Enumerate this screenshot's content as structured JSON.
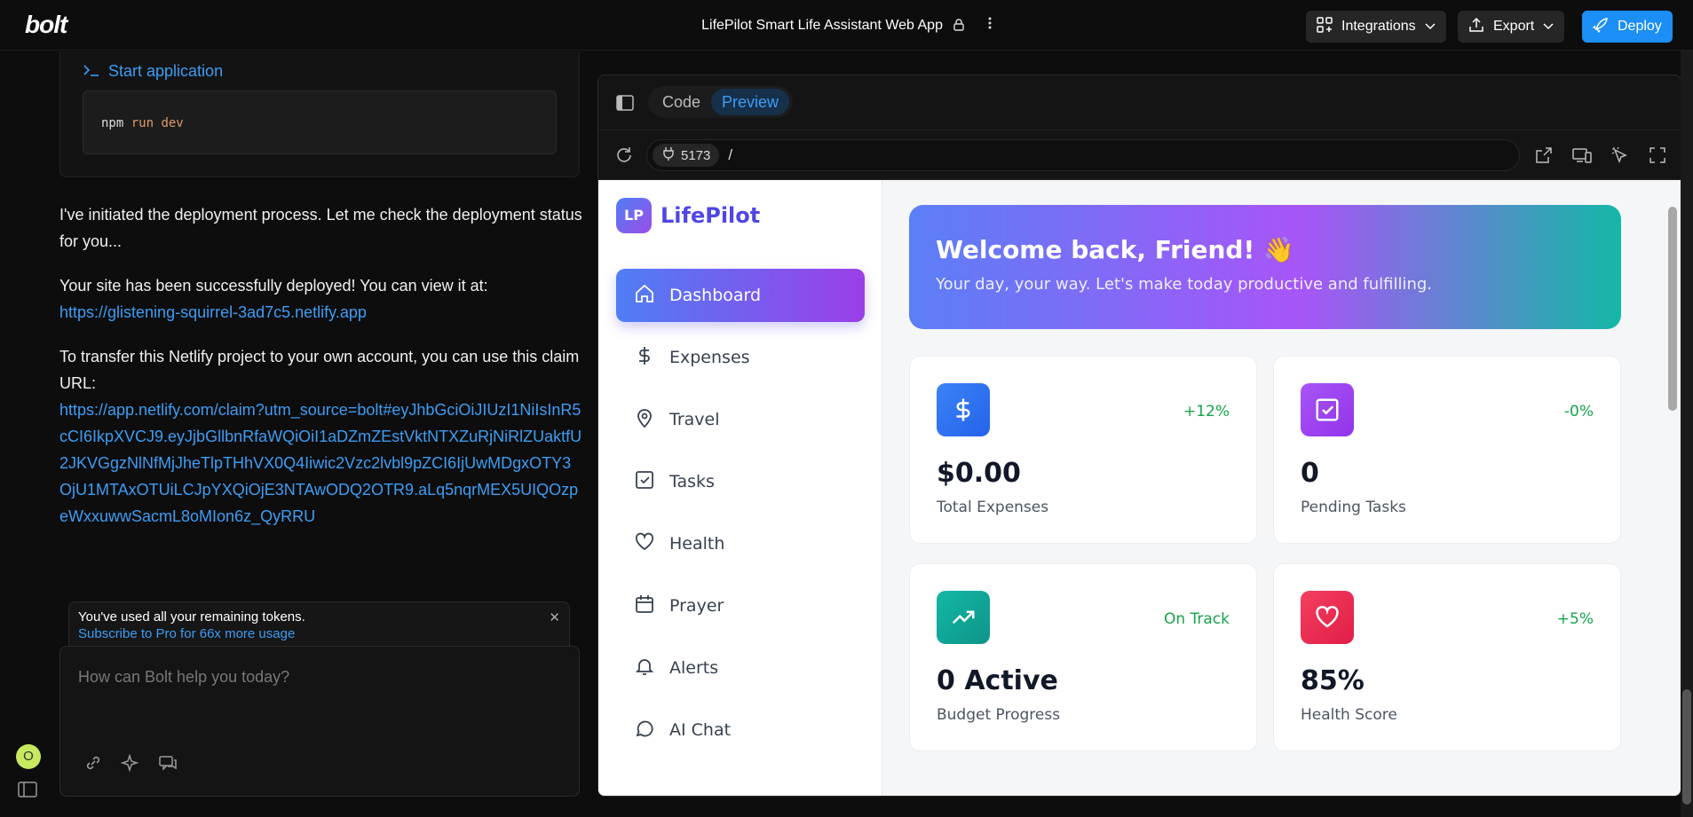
{
  "topbar": {
    "logo": "bolt",
    "project_title": "LifePilot Smart Life Assistant Web App",
    "integrations_label": "Integrations",
    "export_label": "Export",
    "deploy_label": "Deploy"
  },
  "chat": {
    "start_app_label": "Start application",
    "cmd_prefix": "npm",
    "cmd_rest": "run dev",
    "msg1": "I've initiated the deployment process. Let me check the deployment status for you...",
    "msg2": "Your site has been successfully deployed! You can view it at:",
    "site_url": "https://glistening-squirrel-3ad7c5.netlify.app",
    "msg3": "To transfer this Netlify project to your own account, you can use  this claim URL:",
    "claim_url": "https://app.netlify.com/claim?utm_source=bolt#eyJhbGciOiJIUzI1NiIsInR5cCI6IkpXVCJ9.eyJjbGllbnRfaWQiOiI1aDZmZEstVktNTXZuRjNiRlZUaktfU2JKVGgzNlNfMjJheTlpTHhVX0Q4Iiwic2Vzc2lvbl9pZCI6IjUwMDgxOTY3OjU1MTAxOTUiLCJpYXQiOjE3NTAwODQ2OTR9.aLq5nqrMEX5UIQOzpeWxxuwwSacmL8oMIon6z_QyRRU",
    "notice_title": "You've used all your remaining tokens.",
    "notice_link": "Subscribe to Pro for 66x more usage",
    "input_placeholder": "How can Bolt help you today?",
    "avatar_initial": "O"
  },
  "preview": {
    "tab_code": "Code",
    "tab_preview": "Preview",
    "port": "5173",
    "path": "/"
  },
  "app": {
    "brand_badge": "LP",
    "brand_name": "LifePilot",
    "nav": [
      {
        "label": "Dashboard",
        "icon": "home-icon"
      },
      {
        "label": "Expenses",
        "icon": "dollar-icon"
      },
      {
        "label": "Travel",
        "icon": "map-pin-icon"
      },
      {
        "label": "Tasks",
        "icon": "checkbox-icon"
      },
      {
        "label": "Health",
        "icon": "heart-icon"
      },
      {
        "label": "Prayer",
        "icon": "calendar-icon"
      },
      {
        "label": "Alerts",
        "icon": "bell-icon"
      },
      {
        "label": "AI Chat",
        "icon": "chat-bubble-icon"
      }
    ],
    "hero_title": "Welcome back, Friend! 👋",
    "hero_subtitle": "Your day, your way. Let's make today productive and fulfilling.",
    "cards": [
      {
        "value": "$0.00",
        "label": "Total Expenses",
        "change": "+12%",
        "color": "#3b6ff0"
      },
      {
        "value": "0",
        "label": "Pending Tasks",
        "change": "-0%",
        "color": "#a33ef0"
      },
      {
        "value": "0 Active",
        "label": "Budget Progress",
        "change": "On Track",
        "color": "#0f9f8f"
      },
      {
        "value": "85%",
        "label": "Health Score",
        "change": "+5%",
        "color": "#e8365a"
      }
    ]
  }
}
